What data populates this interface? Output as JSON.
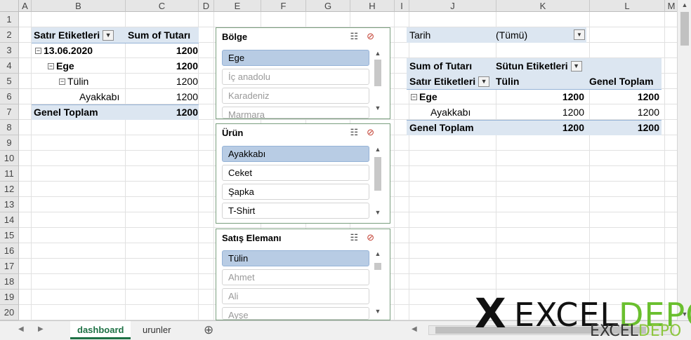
{
  "columns": [
    "A",
    "B",
    "C",
    "D",
    "E",
    "F",
    "G",
    "H",
    "I",
    "J",
    "K",
    "L",
    "M"
  ],
  "rows": [
    "1",
    "2",
    "3",
    "4",
    "5",
    "6",
    "7",
    "8",
    "9",
    "10",
    "11",
    "12",
    "13",
    "14",
    "15",
    "16",
    "17",
    "18",
    "19",
    "20"
  ],
  "pivot1": {
    "row_labels_header": "Satır Etiketleri",
    "sum_header": "Sum of Tutarı",
    "rows": [
      {
        "label": "13.06.2020",
        "value": "1200"
      },
      {
        "label": "Ege",
        "value": "1200"
      },
      {
        "label": "Tülin",
        "value": "1200"
      },
      {
        "label": "Ayakkabı",
        "value": "1200"
      }
    ],
    "total_label": "Genel Toplam",
    "total_value": "1200"
  },
  "pivot2": {
    "filter_label": "Tarih",
    "filter_value": "(Tümü)",
    "sum_header": "Sum of Tutarı",
    "col_labels_header": "Sütun Etiketleri",
    "row_labels_header": "Satır Etiketleri",
    "col_tulin": "Tülin",
    "col_total": "Genel Toplam",
    "row_ege": "Ege",
    "row_ege_tulin": "1200",
    "row_ege_total": "1200",
    "row_ayakkabi": "Ayakkabı",
    "row_ayakkabi_tulin": "1200",
    "row_ayakkabi_total": "1200",
    "total_label": "Genel Toplam",
    "total_tulin": "1200",
    "total_total": "1200"
  },
  "slicers": [
    {
      "title": "Bölge",
      "items": [
        {
          "label": "Ege",
          "state": "sel"
        },
        {
          "label": "İç anadolu",
          "state": "dim"
        },
        {
          "label": "Karadeniz",
          "state": "dim"
        },
        {
          "label": "Marmara",
          "state": "dim"
        }
      ]
    },
    {
      "title": "Ürün",
      "items": [
        {
          "label": "Ayakkabı",
          "state": "sel"
        },
        {
          "label": "Ceket",
          "state": ""
        },
        {
          "label": "Şapka",
          "state": ""
        },
        {
          "label": "T-Shirt",
          "state": ""
        }
      ]
    },
    {
      "title": "Satış Elemanı",
      "items": [
        {
          "label": "Tülin",
          "state": "sel"
        },
        {
          "label": "Ahmet",
          "state": "dim"
        },
        {
          "label": "Ali",
          "state": "dim"
        },
        {
          "label": "Ayşe",
          "state": "dim"
        }
      ]
    }
  ],
  "tabs": {
    "dashboard": "dashboard",
    "urunler": "urunler",
    "add": "⊕"
  },
  "logo": {
    "x": "X",
    "part1": "EXCEL",
    "part2": "DEPO",
    "small_part1": "EXCEL",
    "small_part2": "DEPO"
  },
  "colors": {
    "pivot_band": "#dce6f1",
    "slicer_selected": "#b8cce4",
    "active_tab": "#1e7145",
    "logo_green": "#6abf2e"
  }
}
